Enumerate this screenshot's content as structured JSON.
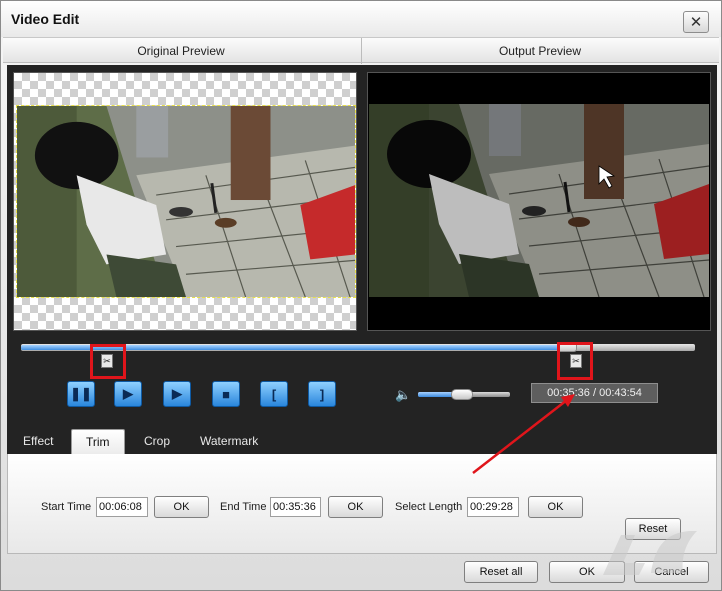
{
  "window": {
    "title": "Video Edit",
    "close_glyph": "✕"
  },
  "preview": {
    "original_label": "Original Preview",
    "output_label": "Output Preview"
  },
  "timeline": {
    "progress_fraction": 0.81,
    "start_marker_glyph": "✂",
    "end_marker_glyph": "✂"
  },
  "controls": {
    "pause_glyph": "❚❚",
    "next_frame_glyph": "▶",
    "step_glyph": "▶",
    "stop_glyph": "■",
    "set_start_glyph": "[",
    "set_end_glyph": "]",
    "volume_glyph": "🔈",
    "volume_fraction": 0.48,
    "time": "00:35:36 / 00:43:54"
  },
  "tabs": [
    {
      "label": "Effect"
    },
    {
      "label": "Trim"
    },
    {
      "label": "Crop"
    },
    {
      "label": "Watermark"
    }
  ],
  "trim": {
    "start_time_label": "Start Time",
    "start_time_value": "00:06:08",
    "end_time_label": "End Time",
    "end_time_value": "00:35:36",
    "select_length_label": "Select Length",
    "select_length_value": "00:29:28",
    "ok_label": "OK",
    "reset_label": "Reset"
  },
  "footer": {
    "reset_all_label": "Reset all",
    "ok_label": "OK",
    "cancel_label": "Cancel"
  },
  "colors": {
    "accent_blue": "#3f8ee0",
    "highlight_red": "#e0151b",
    "panel_dark": "#232323"
  }
}
